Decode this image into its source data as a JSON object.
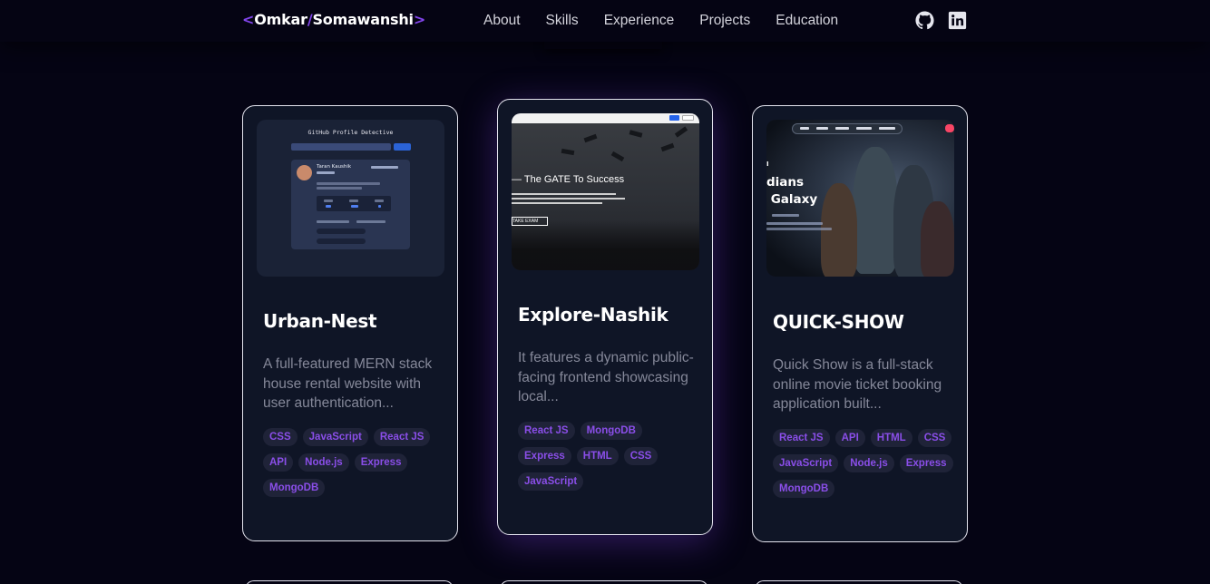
{
  "nav": {
    "logo": {
      "bracket_open": "<",
      "first": "Omkar",
      "slash": "/",
      "last": "Somawanshi",
      "bracket_close": ">"
    },
    "links": [
      "About",
      "Skills",
      "Experience",
      "Projects",
      "Education"
    ],
    "icons": [
      "github-icon",
      "linkedin-icon"
    ]
  },
  "colors": {
    "accent": "#8245ec",
    "background": "#050414",
    "card": "#0f1526",
    "tag_text": "#8a4ee8"
  },
  "projects": [
    {
      "title": "Urban-Nest",
      "description": "A full-featured MERN stack house rental website with user authentication...",
      "tags": [
        "CSS",
        "JavaScript",
        "React JS",
        "API",
        "Node.js",
        "Express",
        "MongoDB"
      ],
      "thumbnail": {
        "heading": "GitHub Profile Detective",
        "name": "Taran Kaushik"
      }
    },
    {
      "title": "Explore-Nashik",
      "description": "It features a dynamic public-facing frontend showcasing local...",
      "tags": [
        "React JS",
        "MongoDB",
        "Express",
        "HTML",
        "CSS",
        "JavaScript"
      ],
      "thumbnail": {
        "heading": "The GATE To Success",
        "button": "TAKE EXAM"
      }
    },
    {
      "title": "QUICK-SHOW",
      "description": "Quick Show is a full-stack online movie ticket booking application built...",
      "tags": [
        "React JS",
        "API",
        "HTML",
        "CSS",
        "JavaScript",
        "Node.js",
        "Express",
        "MongoDB"
      ],
      "thumbnail": {
        "heading_line1": "dians",
        "heading_line2": "Galaxy"
      }
    }
  ]
}
